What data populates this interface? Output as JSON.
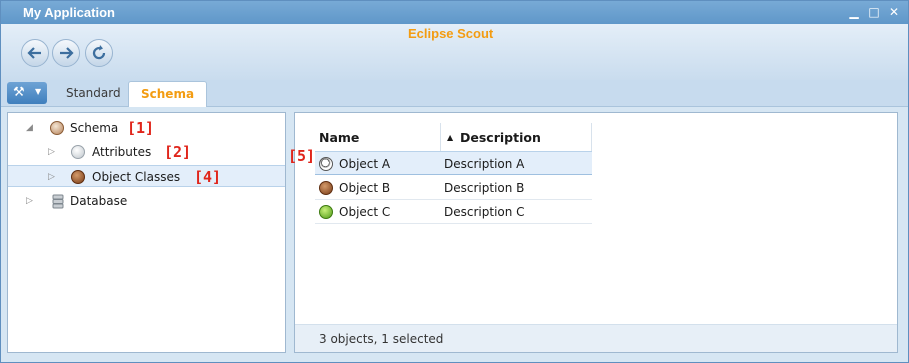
{
  "window": {
    "title": "My Application",
    "brand": "Eclipse Scout",
    "minimize_glyph": "▁",
    "maximize_glyph": "□",
    "close_glyph": "✕"
  },
  "navigation": {
    "back_icon": "back-arrow-icon",
    "forward_icon": "forward-arrow-icon",
    "refresh_icon": "refresh-icon"
  },
  "tabs": [
    {
      "label": "Standard",
      "active": false
    },
    {
      "label": "Schema",
      "active": true
    }
  ],
  "tree": {
    "nodes": [
      {
        "label": "Schema",
        "annotation": "[1]",
        "expander": "◢"
      },
      {
        "label": "Attributes",
        "annotation": "[2]",
        "expander": "▷"
      },
      {
        "label": "Object Classes",
        "annotation": "[4]",
        "expander": "▷",
        "selected": true
      },
      {
        "label": "Database",
        "annotation": "",
        "expander": "▷"
      }
    ]
  },
  "table": {
    "annotation": "[5]",
    "columns": [
      {
        "label": "Name"
      },
      {
        "label": "Description",
        "sort_indicator": "▲"
      }
    ],
    "rows": [
      {
        "name": "Object A",
        "description": "Description A",
        "icon": "soccer-ball-icon",
        "selected": true
      },
      {
        "name": "Object B",
        "description": "Description B",
        "icon": "football-icon"
      },
      {
        "name": "Object C",
        "description": "Description C",
        "icon": "tennis-ball-icon"
      }
    ],
    "status": "3 objects, 1 selected"
  },
  "colors": {
    "accent": "#f39c12",
    "annotation": "#e0251b",
    "titlebar": "#6a9fcf",
    "selection": "#e3eefa"
  }
}
